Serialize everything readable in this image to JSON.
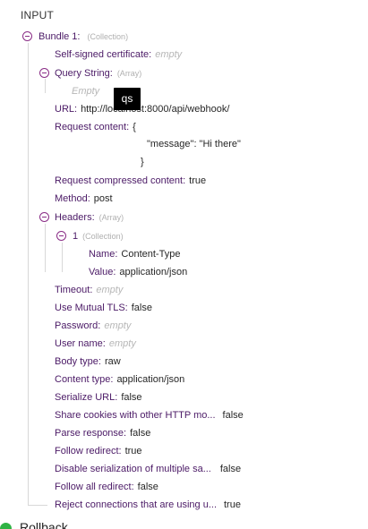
{
  "section_title": "INPUT",
  "tooltip": "qs",
  "bundle": {
    "label": "Bundle 1:",
    "type": "(Collection)"
  },
  "rows": {
    "self_signed": {
      "key": "Self-signed certificate:",
      "empty": "empty"
    },
    "query_string": {
      "key": "Query String:",
      "type": "(Array)",
      "empty": "Empty"
    },
    "url": {
      "key": "URL:",
      "value": "http://localhost:8000/api/webhook/"
    },
    "request_content": {
      "key": "Request content:",
      "line1": "{",
      "line2": "\"message\": \"Hi there\"",
      "line3": "}"
    },
    "request_compressed": {
      "key": "Request compressed content:",
      "value": "true"
    },
    "method": {
      "key": "Method:",
      "value": "post"
    },
    "headers": {
      "key": "Headers:",
      "type": "(Array)"
    },
    "header_item": {
      "key": "1",
      "type": "(Collection)"
    },
    "header_name": {
      "key": "Name:",
      "value": "Content-Type"
    },
    "header_value": {
      "key": "Value:",
      "value": "application/json"
    },
    "timeout": {
      "key": "Timeout:",
      "empty": "empty"
    },
    "mutual_tls": {
      "key": "Use Mutual TLS:",
      "value": "false"
    },
    "password": {
      "key": "Password:",
      "empty": "empty"
    },
    "user_name": {
      "key": "User name:",
      "empty": "empty"
    },
    "body_type": {
      "key": "Body type:",
      "value": "raw"
    },
    "content_type": {
      "key": "Content type:",
      "value": "application/json"
    },
    "serialize_url": {
      "key": "Serialize URL:",
      "value": "false"
    },
    "share_cookies": {
      "key": "Share cookies with other HTTP mo...",
      "value": "false"
    },
    "parse_response": {
      "key": "Parse response:",
      "value": "false"
    },
    "follow_redirect": {
      "key": "Follow redirect:",
      "value": "true"
    },
    "disable_serialization": {
      "key": "Disable serialization of multiple sa...",
      "value": "false"
    },
    "follow_all_redirect": {
      "key": "Follow all redirect:",
      "value": "false"
    },
    "reject_connections": {
      "key": "Reject connections that are using u...",
      "value": "true"
    }
  },
  "footer": {
    "label": "Rollback"
  },
  "colors": {
    "key": "#4b1a66",
    "toggle": "#8a2d86",
    "success": "#2fb344"
  }
}
